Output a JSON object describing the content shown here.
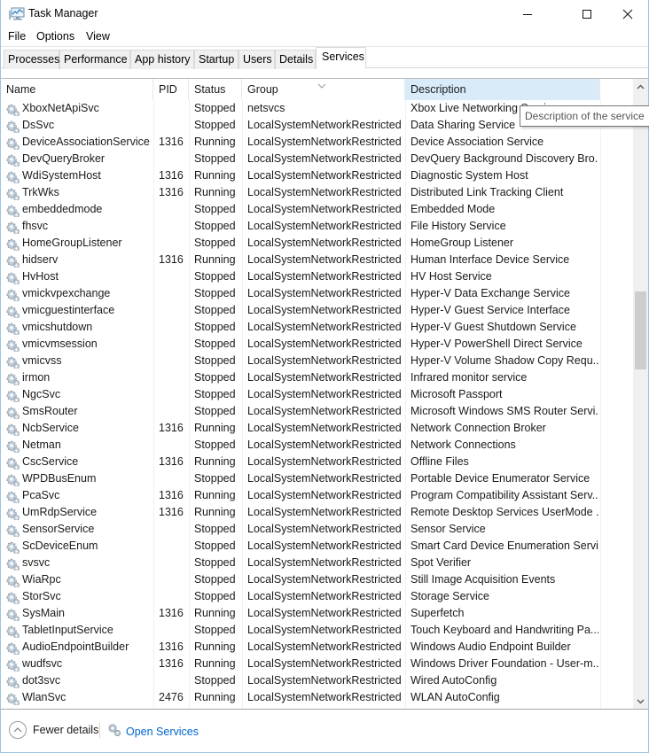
{
  "window": {
    "title": "Task Manager",
    "controls": {
      "minimize": "minimize",
      "maximize": "maximize",
      "close": "close"
    }
  },
  "menu": [
    "File",
    "Options",
    "View"
  ],
  "tabs": [
    {
      "label": "Processes",
      "active": false
    },
    {
      "label": "Performance",
      "active": false
    },
    {
      "label": "App history",
      "active": false
    },
    {
      "label": "Startup",
      "active": false
    },
    {
      "label": "Users",
      "active": false
    },
    {
      "label": "Details",
      "active": false
    },
    {
      "label": "Services",
      "active": true
    }
  ],
  "table": {
    "columns": [
      "Name",
      "PID",
      "Status",
      "Group",
      "Description"
    ],
    "sorted_column": "Description",
    "rows": [
      {
        "name": "XboxNetApiSvc",
        "pid": "",
        "status": "Stopped",
        "group": "netsvcs",
        "description": "Xbox Live Networking Service"
      },
      {
        "name": "DsSvc",
        "pid": "",
        "status": "Stopped",
        "group": "LocalSystemNetworkRestricted",
        "description": "Data Sharing Service"
      },
      {
        "name": "DeviceAssociationService",
        "pid": "1316",
        "status": "Running",
        "group": "LocalSystemNetworkRestricted",
        "description": "Device Association Service"
      },
      {
        "name": "DevQueryBroker",
        "pid": "",
        "status": "Stopped",
        "group": "LocalSystemNetworkRestricted",
        "description": "DevQuery Background Discovery Bro..."
      },
      {
        "name": "WdiSystemHost",
        "pid": "1316",
        "status": "Running",
        "group": "LocalSystemNetworkRestricted",
        "description": "Diagnostic System Host"
      },
      {
        "name": "TrkWks",
        "pid": "1316",
        "status": "Running",
        "group": "LocalSystemNetworkRestricted",
        "description": "Distributed Link Tracking Client"
      },
      {
        "name": "embeddedmode",
        "pid": "",
        "status": "Stopped",
        "group": "LocalSystemNetworkRestricted",
        "description": "Embedded Mode"
      },
      {
        "name": "fhsvc",
        "pid": "",
        "status": "Stopped",
        "group": "LocalSystemNetworkRestricted",
        "description": "File History Service"
      },
      {
        "name": "HomeGroupListener",
        "pid": "",
        "status": "Stopped",
        "group": "LocalSystemNetworkRestricted",
        "description": "HomeGroup Listener"
      },
      {
        "name": "hidserv",
        "pid": "1316",
        "status": "Running",
        "group": "LocalSystemNetworkRestricted",
        "description": "Human Interface Device Service"
      },
      {
        "name": "HvHost",
        "pid": "",
        "status": "Stopped",
        "group": "LocalSystemNetworkRestricted",
        "description": "HV Host Service"
      },
      {
        "name": "vmickvpexchange",
        "pid": "",
        "status": "Stopped",
        "group": "LocalSystemNetworkRestricted",
        "description": "Hyper-V Data Exchange Service"
      },
      {
        "name": "vmicguestinterface",
        "pid": "",
        "status": "Stopped",
        "group": "LocalSystemNetworkRestricted",
        "description": "Hyper-V Guest Service Interface"
      },
      {
        "name": "vmicshutdown",
        "pid": "",
        "status": "Stopped",
        "group": "LocalSystemNetworkRestricted",
        "description": "Hyper-V Guest Shutdown Service"
      },
      {
        "name": "vmicvmsession",
        "pid": "",
        "status": "Stopped",
        "group": "LocalSystemNetworkRestricted",
        "description": "Hyper-V PowerShell Direct Service"
      },
      {
        "name": "vmicvss",
        "pid": "",
        "status": "Stopped",
        "group": "LocalSystemNetworkRestricted",
        "description": "Hyper-V Volume Shadow Copy Requ..."
      },
      {
        "name": "irmon",
        "pid": "",
        "status": "Stopped",
        "group": "LocalSystemNetworkRestricted",
        "description": "Infrared monitor service"
      },
      {
        "name": "NgcSvc",
        "pid": "",
        "status": "Stopped",
        "group": "LocalSystemNetworkRestricted",
        "description": "Microsoft Passport"
      },
      {
        "name": "SmsRouter",
        "pid": "",
        "status": "Stopped",
        "group": "LocalSystemNetworkRestricted",
        "description": "Microsoft Windows SMS Router Servi..."
      },
      {
        "name": "NcbService",
        "pid": "1316",
        "status": "Running",
        "group": "LocalSystemNetworkRestricted",
        "description": "Network Connection Broker"
      },
      {
        "name": "Netman",
        "pid": "",
        "status": "Stopped",
        "group": "LocalSystemNetworkRestricted",
        "description": "Network Connections"
      },
      {
        "name": "CscService",
        "pid": "1316",
        "status": "Running",
        "group": "LocalSystemNetworkRestricted",
        "description": "Offline Files"
      },
      {
        "name": "WPDBusEnum",
        "pid": "",
        "status": "Stopped",
        "group": "LocalSystemNetworkRestricted",
        "description": "Portable Device Enumerator Service"
      },
      {
        "name": "PcaSvc",
        "pid": "1316",
        "status": "Running",
        "group": "LocalSystemNetworkRestricted",
        "description": "Program Compatibility Assistant Serv..."
      },
      {
        "name": "UmRdpService",
        "pid": "1316",
        "status": "Running",
        "group": "LocalSystemNetworkRestricted",
        "description": "Remote Desktop Services UserMode ..."
      },
      {
        "name": "SensorService",
        "pid": "",
        "status": "Stopped",
        "group": "LocalSystemNetworkRestricted",
        "description": "Sensor Service"
      },
      {
        "name": "ScDeviceEnum",
        "pid": "",
        "status": "Stopped",
        "group": "LocalSystemNetworkRestricted",
        "description": "Smart Card Device Enumeration Servi..."
      },
      {
        "name": "svsvc",
        "pid": "",
        "status": "Stopped",
        "group": "LocalSystemNetworkRestricted",
        "description": "Spot Verifier"
      },
      {
        "name": "WiaRpc",
        "pid": "",
        "status": "Stopped",
        "group": "LocalSystemNetworkRestricted",
        "description": "Still Image Acquisition Events"
      },
      {
        "name": "StorSvc",
        "pid": "",
        "status": "Stopped",
        "group": "LocalSystemNetworkRestricted",
        "description": "Storage Service"
      },
      {
        "name": "SysMain",
        "pid": "1316",
        "status": "Running",
        "group": "LocalSystemNetworkRestricted",
        "description": "Superfetch"
      },
      {
        "name": "TabletInputService",
        "pid": "",
        "status": "Stopped",
        "group": "LocalSystemNetworkRestricted",
        "description": "Touch Keyboard and Handwriting Pa..."
      },
      {
        "name": "AudioEndpointBuilder",
        "pid": "1316",
        "status": "Running",
        "group": "LocalSystemNetworkRestricted",
        "description": "Windows Audio Endpoint Builder"
      },
      {
        "name": "wudfsvc",
        "pid": "1316",
        "status": "Running",
        "group": "LocalSystemNetworkRestricted",
        "description": "Windows Driver Foundation - User-m..."
      },
      {
        "name": "dot3svc",
        "pid": "",
        "status": "Stopped",
        "group": "LocalSystemNetworkRestricted",
        "description": "Wired AutoConfig"
      },
      {
        "name": "WlanSvc",
        "pid": "2476",
        "status": "Running",
        "group": "LocalSystemNetworkRestricted",
        "description": "WLAN AutoConfig"
      }
    ]
  },
  "tooltip": {
    "text": "Description of the service"
  },
  "footer": {
    "fewer_details": "Fewer details",
    "open_services": "Open Services"
  },
  "colors": {
    "link": "#0066cc",
    "sorted_header_bg": "#d9ebf9",
    "scroll_thumb": "#cdcdcd"
  },
  "scroll": {
    "thumb_position_fraction": 0.33,
    "thumb_size_fraction": 0.13
  }
}
